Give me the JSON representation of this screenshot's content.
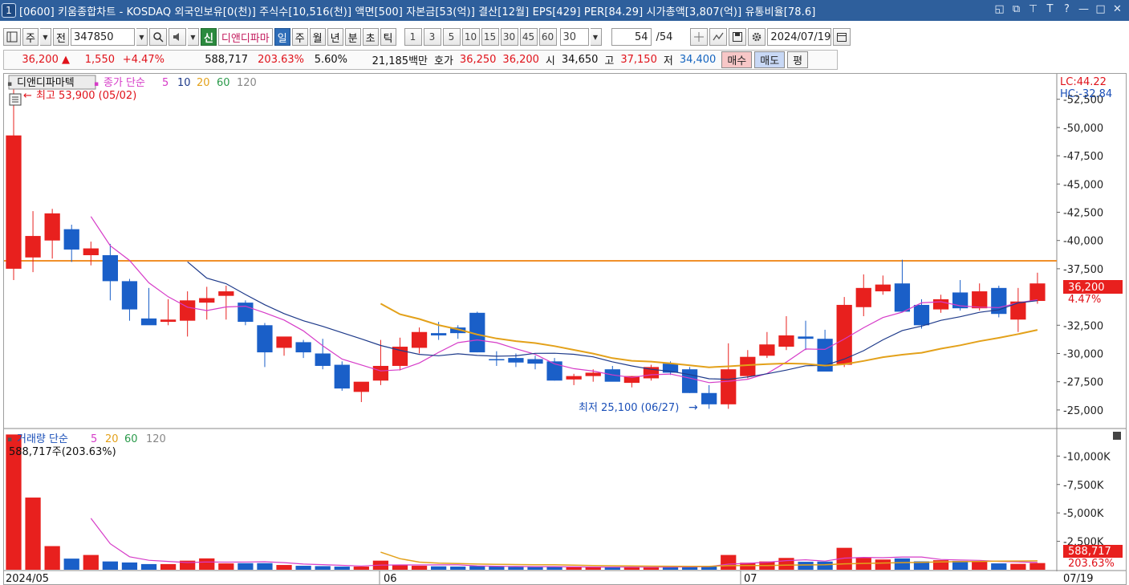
{
  "titlebar": {
    "window_number": "1",
    "title": "[0600] 키움종합차트 - KOSDAQ 외국인보유[0(천)] 주식수[10,516(천)] 액면[500] 자본금[53(억)] 결산[12월] EPS[429] PER[84.29] 시가총액[3,807(억)] 유통비율[78.6]",
    "controls": [
      "◱",
      "⧉",
      "⊤",
      "T",
      "?",
      "—",
      "□",
      "✕"
    ]
  },
  "toolbar": {
    "period_label": "주",
    "prev_label": "전",
    "stock_code": "347850",
    "stock_prefix": "신",
    "stock_name": "디앤디파마",
    "tabs": [
      "일",
      "주",
      "월",
      "년",
      "분",
      "초",
      "틱"
    ],
    "active_tab": "일",
    "numbers": [
      "1",
      "3",
      "5",
      "10",
      "15",
      "30",
      "45",
      "60"
    ],
    "count_value": "30",
    "page_current": "54",
    "page_total": "/54",
    "date": "2024/07/19"
  },
  "quote": {
    "price": "36,200",
    "change": "1,550",
    "change_pct": "+4.47%",
    "volume": "588,717",
    "volume_pct": "203.63%",
    "turnover_pct": "5.60%",
    "amount": "21,185백만",
    "ask_label": "호가",
    "ask": "36,250",
    "bid": "36,200",
    "open_label": "시",
    "open": "34,650",
    "high_label": "고",
    "high": "37,150",
    "low_label": "저",
    "low": "34,400",
    "buy_label": "매수",
    "sell_label": "매도",
    "flat_label": "평"
  },
  "chart": {
    "price_legend": {
      "name": "디앤디파마텍",
      "ma_title": "종가 단순",
      "ma_periods": [
        "5",
        "10",
        "20",
        "60",
        "120"
      ]
    },
    "volume_legend": {
      "name": "거래량 단순",
      "ma_periods": [
        "5",
        "20",
        "60",
        "120"
      ],
      "info": "588,717주(203.63%)"
    },
    "high_marker": "최고 53,900 (05/02)",
    "low_marker": "최저 25,100 (06/27)",
    "lc": "LC:44.22",
    "hc": "HC:-32.84",
    "price_tag": "36,200",
    "price_tag_pct": "4.47%",
    "volume_tag": "588,717",
    "volume_tag_pct": "203.63%",
    "price_ticks": [
      "52,500",
      "50,000",
      "47,500",
      "45,000",
      "42,500",
      "40,000",
      "37,500",
      "32,500",
      "30,000",
      "27,500",
      "25,000"
    ],
    "volume_ticks": [
      "10,000K",
      "7,500K",
      "5,000K",
      "2,500K"
    ],
    "x_labels": [
      "2024/05",
      "06",
      "07",
      "07/19"
    ],
    "colors": {
      "up": "#e8201e",
      "down": "#1a5fc8",
      "ma5": "#d63cc8",
      "ma10": "#1e3a8a",
      "ma20": "#e3a11a",
      "hline": "#f0902a"
    }
  },
  "chart_data": {
    "type": "candlestick",
    "ohlc_fields": [
      "open",
      "high",
      "low",
      "close"
    ],
    "candles": [
      [
        37500,
        53900,
        36500,
        49300
      ],
      [
        38500,
        42600,
        37200,
        40400
      ],
      [
        40000,
        42800,
        38400,
        42400
      ],
      [
        41000,
        41400,
        38100,
        39200
      ],
      [
        38700,
        39900,
        37800,
        39300
      ],
      [
        38700,
        39700,
        34700,
        36400
      ],
      [
        36400,
        36600,
        32900,
        33900
      ],
      [
        33100,
        35800,
        32600,
        32500
      ],
      [
        32800,
        34800,
        32500,
        33000
      ],
      [
        32900,
        35500,
        31500,
        34700
      ],
      [
        34500,
        35900,
        33000,
        34900
      ],
      [
        35100,
        36000,
        33000,
        35500
      ],
      [
        34500,
        34700,
        32500,
        32800
      ],
      [
        32500,
        32700,
        28800,
        30100
      ],
      [
        30500,
        31200,
        29800,
        31500
      ],
      [
        31000,
        31200,
        29600,
        30100
      ],
      [
        30000,
        31300,
        28600,
        28900
      ],
      [
        29000,
        29300,
        26700,
        26900
      ],
      [
        26600,
        27100,
        25700,
        27500
      ],
      [
        27600,
        31200,
        27200,
        28900
      ],
      [
        28900,
        31400,
        28500,
        30600
      ],
      [
        30500,
        32300,
        30000,
        31900
      ],
      [
        31800,
        32800,
        31200,
        31600
      ],
      [
        32300,
        32500,
        31300,
        31800
      ],
      [
        33600,
        33700,
        30100,
        30100
      ],
      [
        29500,
        30200,
        28900,
        29400
      ],
      [
        29600,
        30000,
        28800,
        29200
      ],
      [
        29500,
        29800,
        28600,
        29100
      ],
      [
        29300,
        29600,
        27600,
        27600
      ],
      [
        27700,
        28200,
        27200,
        28000
      ],
      [
        28000,
        28600,
        27500,
        28300
      ],
      [
        28600,
        28900,
        27800,
        27500
      ],
      [
        27400,
        28000,
        27000,
        28000
      ],
      [
        27800,
        29000,
        27600,
        28800
      ],
      [
        29100,
        29300,
        28100,
        28300
      ],
      [
        28600,
        28800,
        26500,
        26500
      ],
      [
        26500,
        27200,
        25100,
        25500
      ],
      [
        25500,
        30900,
        25100,
        28600
      ],
      [
        28000,
        30300,
        27800,
        29700
      ],
      [
        29800,
        31900,
        29600,
        30800
      ],
      [
        30600,
        33300,
        30300,
        31600
      ],
      [
        31500,
        32900,
        30300,
        31300
      ],
      [
        31300,
        32100,
        28400,
        28400
      ],
      [
        29000,
        35000,
        28800,
        34300
      ],
      [
        34100,
        37000,
        33300,
        35800
      ],
      [
        35500,
        36900,
        35200,
        36100
      ],
      [
        36200,
        38300,
        33800,
        33700
      ],
      [
        34300,
        34800,
        32200,
        32500
      ],
      [
        33900,
        35200,
        33600,
        34800
      ],
      [
        35400,
        36500,
        33800,
        34000
      ],
      [
        34000,
        36200,
        33800,
        35500
      ],
      [
        35800,
        36000,
        33200,
        33500
      ],
      [
        33000,
        35800,
        31900,
        34600
      ],
      [
        34650,
        37150,
        34400,
        36200
      ]
    ],
    "volumes_k": [
      11900,
      6350,
      2080,
      980,
      1300,
      730,
      640,
      500,
      500,
      800,
      1000,
      560,
      580,
      580,
      420,
      350,
      320,
      280,
      280,
      800,
      420,
      350,
      300,
      280,
      330,
      280,
      260,
      240,
      260,
      220,
      230,
      230,
      220,
      240,
      260,
      320,
      340,
      1300,
      620,
      730,
      1040,
      700,
      720,
      1930,
      1050,
      900,
      1000,
      740,
      840,
      780,
      760,
      560,
      520,
      589
    ],
    "x_labels": [
      "2024/05",
      "06",
      "07",
      "07/19"
    ],
    "hline": 38200,
    "ylim": [
      23500,
      53900
    ],
    "volume_ylim": [
      0,
      12000
    ]
  }
}
